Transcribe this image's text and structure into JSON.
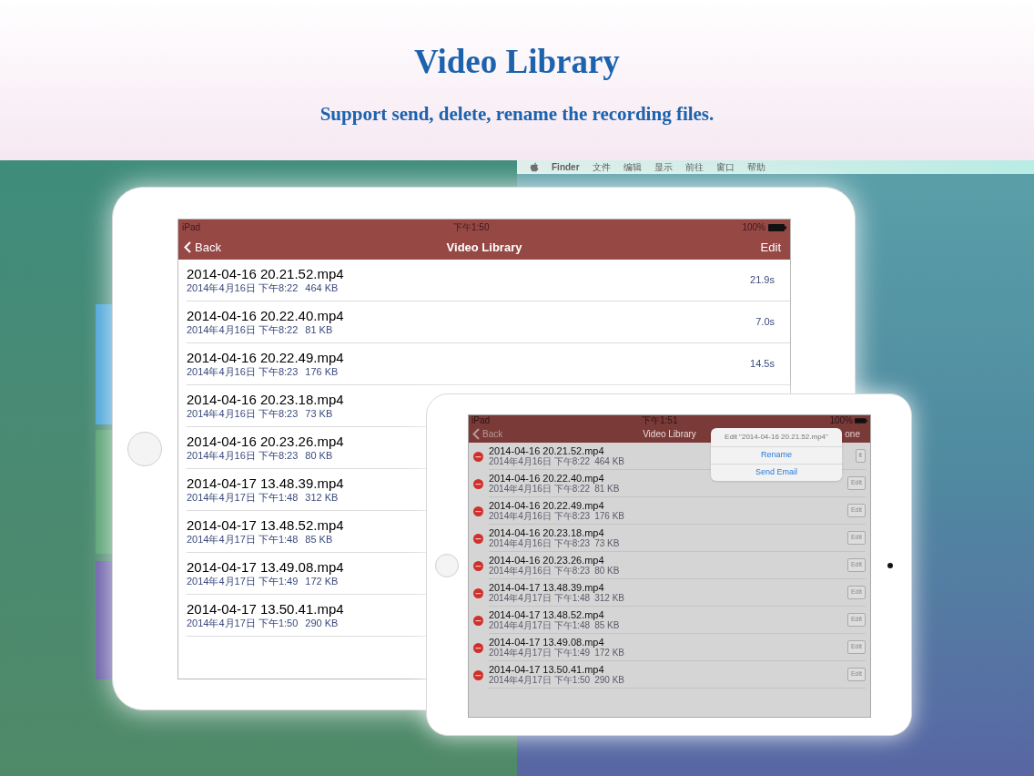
{
  "header": {
    "title": "Video Library",
    "subtitle": "Support send, delete, rename the recording files."
  },
  "desktop": {
    "menu_bar": [
      "Finder",
      "文件",
      "编辑",
      "显示",
      "前往",
      "窗口",
      "帮助"
    ]
  },
  "ipad_list": {
    "status": {
      "carrier": "iPad",
      "time": "下午1:50",
      "battery": "100%"
    },
    "nav": {
      "back": "Back",
      "title": "Video Library",
      "action": "Edit"
    },
    "rows": [
      {
        "name": "2014-04-16 20.21.52.mp4",
        "date": "2014年4月16日 下午8:22",
        "size": "464 KB",
        "duration": "21.9s"
      },
      {
        "name": "2014-04-16 20.22.40.mp4",
        "date": "2014年4月16日 下午8:22",
        "size": "81 KB",
        "duration": "7.0s"
      },
      {
        "name": "2014-04-16 20.22.49.mp4",
        "date": "2014年4月16日 下午8:23",
        "size": "176 KB",
        "duration": "14.5s"
      },
      {
        "name": "2014-04-16 20.23.18.mp4",
        "date": "2014年4月16日 下午8:23",
        "size": "73 KB"
      },
      {
        "name": "2014-04-16 20.23.26.mp4",
        "date": "2014年4月16日 下午8:23",
        "size": "80 KB"
      },
      {
        "name": "2014-04-17 13.48.39.mp4",
        "date": "2014年4月17日 下午1:48",
        "size": "312 KB"
      },
      {
        "name": "2014-04-17 13.48.52.mp4",
        "date": "2014年4月17日 下午1:48",
        "size": "85 KB"
      },
      {
        "name": "2014-04-17 13.49.08.mp4",
        "date": "2014年4月17日 下午1:49",
        "size": "172 KB"
      },
      {
        "name": "2014-04-17 13.50.41.mp4",
        "date": "2014年4月17日 下午1:50",
        "size": "290 KB"
      }
    ]
  },
  "ipad_edit": {
    "status": {
      "carrier": "iPad",
      "time": "下午1:51",
      "battery": "100%"
    },
    "nav": {
      "back": "Back",
      "title": "Video Library",
      "action": "one"
    },
    "rows": [
      {
        "name": "2014-04-16 20.21.52.mp4",
        "date": "2014年4月16日 下午8:22",
        "size": "464 KB",
        "button": "it"
      },
      {
        "name": "2014-04-16 20.22.40.mp4",
        "date": "2014年4月16日 下午8:22",
        "size": "81 KB",
        "button": "Edit"
      },
      {
        "name": "2014-04-16 20.22.49.mp4",
        "date": "2014年4月16日 下午8:23",
        "size": "176 KB",
        "button": "Edit"
      },
      {
        "name": "2014-04-16 20.23.18.mp4",
        "date": "2014年4月16日 下午8:23",
        "size": "73 KB",
        "button": "Edit"
      },
      {
        "name": "2014-04-16 20.23.26.mp4",
        "date": "2014年4月16日 下午8:23",
        "size": "80 KB",
        "button": "Edit"
      },
      {
        "name": "2014-04-17 13.48.39.mp4",
        "date": "2014年4月17日 下午1:48",
        "size": "312 KB",
        "button": "Edit"
      },
      {
        "name": "2014-04-17 13.48.52.mp4",
        "date": "2014年4月17日 下午1:48",
        "size": "85 KB",
        "button": "Edit"
      },
      {
        "name": "2014-04-17 13.49.08.mp4",
        "date": "2014年4月17日 下午1:49",
        "size": "172 KB",
        "button": "Edit"
      },
      {
        "name": "2014-04-17 13.50.41.mp4",
        "date": "2014年4月17日 下午1:50",
        "size": "290 KB",
        "button": "Edit"
      }
    ],
    "popover": {
      "title": "Edit \"2014-04-16 20.21.52.mp4\"",
      "actions": [
        "Rename",
        "Send Email"
      ]
    }
  }
}
